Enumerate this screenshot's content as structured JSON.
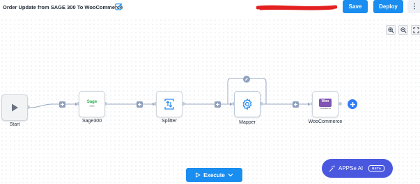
{
  "header": {
    "flow_title": "Order Update from SAGE 300 To WooCommerce",
    "save_label": "Save",
    "deploy_label": "Deploy",
    "more_icon": "more-vertical-icon",
    "edit_icon": "edit-icon"
  },
  "canvas": {
    "nodes": [
      {
        "label": "Start",
        "icon": "play-icon"
      },
      {
        "label": "Sage300",
        "icon": "sage-logo",
        "logo_text": "Sage",
        "logo_sub": "300"
      },
      {
        "label": "Splitter",
        "icon": "split-arrows-icon"
      },
      {
        "label": "Mapper",
        "icon": "gear-icon"
      },
      {
        "label": "WooCommerce",
        "icon": "woocommerce-logo",
        "logo_text": "Woo",
        "logo_sub": "COMMERCE"
      }
    ],
    "zoom_controls": [
      "zoom-in-icon",
      "zoom-out-icon",
      "fullscreen-icon"
    ]
  },
  "footer": {
    "execute_label": "Execute",
    "ai_label": "APPSe AI",
    "ai_badge": "BETA"
  },
  "colors": {
    "primary": "#1a8df0",
    "ai_button": "#4a58e0",
    "connector": "#9aaac4",
    "add_node": "#2f7df6",
    "woo_purple": "#7f54b3",
    "sage_green": "#22b14c"
  }
}
